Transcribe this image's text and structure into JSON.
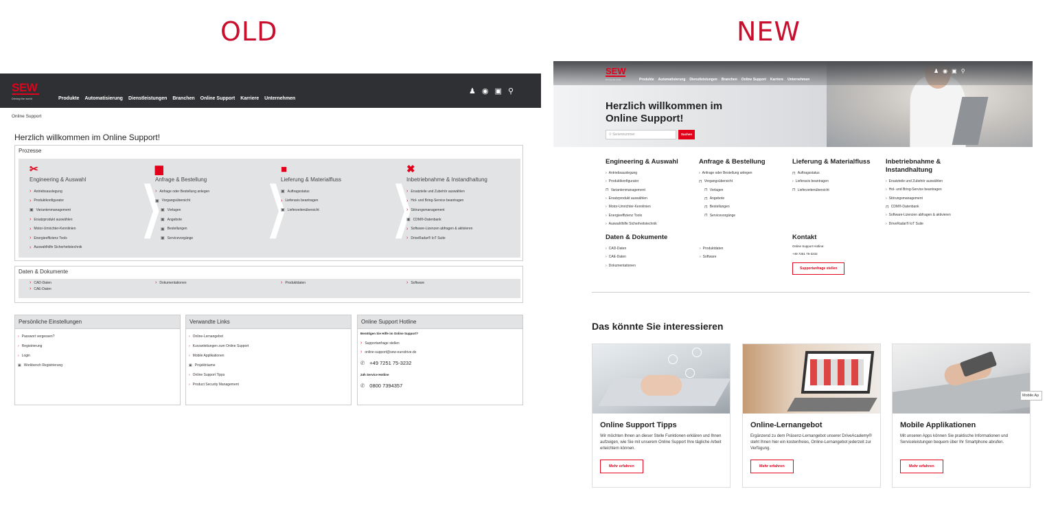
{
  "labels": {
    "old": "OLD",
    "new": "NEW"
  },
  "brand": {
    "logo": "SEW",
    "tagline": "Driving the world"
  },
  "nav": [
    "Produkte",
    "Automatisierung",
    "Dienstleistungen",
    "Branchen",
    "Online Support",
    "Karriere",
    "Unternehmen"
  ],
  "old": {
    "breadcrumb": "Online Support",
    "title": "Herzlich willkommen im Online Support!",
    "prozesse_title": "Prozesse",
    "columns": [
      {
        "title": "Engineering & Auswahl",
        "items": [
          {
            "t": "Antriebsauslegung",
            "lock": false
          },
          {
            "t": "Produktkonfigurator",
            "lock": false
          },
          {
            "t": "Variantenmanagement",
            "lock": true
          },
          {
            "t": "Ersatzprodukt auswählen",
            "lock": false
          },
          {
            "t": "Motor-Umrichter-Kennlinien",
            "lock": false
          },
          {
            "t": "Energieeffizienz Tools",
            "lock": false
          },
          {
            "t": "Auswahlhilfe Sicherheitstechnik",
            "lock": false
          }
        ]
      },
      {
        "title": "Anfrage & Bestellung",
        "items": [
          {
            "t": "Anfrage oder Bestellung anlegen",
            "lock": false
          },
          {
            "t": "Vorgangsübersicht",
            "lock": true
          },
          {
            "t": "Vorlagen",
            "lock": true
          },
          {
            "t": "Angebote",
            "lock": true
          },
          {
            "t": "Bestellungen",
            "lock": true
          },
          {
            "t": "Servicevorgänge",
            "lock": true
          }
        ]
      },
      {
        "title": "Lieferung & Materialfluss",
        "items": [
          {
            "t": "Auftragsstatus",
            "lock": true
          },
          {
            "t": "Lieferavis beantragen",
            "lock": false
          },
          {
            "t": "Lieferzeitenübersicht",
            "lock": true
          }
        ]
      },
      {
        "title": "Inbetriebnahme & Instandhaltung",
        "items": [
          {
            "t": "Ersatzteile und Zubehör auswählen",
            "lock": false
          },
          {
            "t": "Hol- und Bring-Service beantragen",
            "lock": false
          },
          {
            "t": "Störungsmanagement",
            "lock": false
          },
          {
            "t": "CDM®-Datenbank",
            "lock": true
          },
          {
            "t": "Software-Lizenzen abfragen & aktivieren",
            "lock": false
          },
          {
            "t": "DriveRadar® IoT Suite",
            "lock": false
          }
        ]
      }
    ],
    "daten_title": "Daten & Dokumente",
    "daten": [
      "CAD-Daten",
      "CAE-Daten",
      "Dokumentationen",
      "Produktdaten",
      "Software"
    ],
    "pers_title": "Persönliche Einstellungen",
    "pers": [
      {
        "t": "Passwort vergessen?",
        "lock": false
      },
      {
        "t": "Registrierung",
        "lock": false
      },
      {
        "t": "Login",
        "lock": false
      },
      {
        "t": "Workbench Registrierung",
        "lock": true
      }
    ],
    "links_title": "Verwandte Links",
    "links": [
      {
        "t": "Online-Lernangebot",
        "lock": false
      },
      {
        "t": "Kurzanleitungen zum Online Support",
        "lock": false
      },
      {
        "t": "Mobile Applikationen",
        "lock": false
      },
      {
        "t": "Projekträume",
        "lock": true
      },
      {
        "t": "Online Support Tipps",
        "lock": false
      },
      {
        "t": "Product Security Management",
        "lock": false
      }
    ],
    "hotline_title": "Online Support Hotline",
    "hotline_q": "Benötigen Sie Hilfe im Online Support?",
    "hotline_items": [
      "Supportanfrage stellen",
      "online-support@sew-eurodrive.de"
    ],
    "hotline_phone": "+49 7251 75-3232",
    "service_title": "24h Service Hotline",
    "service_phone": "0800 7394357"
  },
  "new": {
    "hero_title": "Herzlich willkommen im Online Support!",
    "search_placeholder": "Seriennummer",
    "search_btn": "Suchen",
    "columns": [
      {
        "title": "Engineering & Auswahl",
        "items": [
          {
            "t": "Antriebsauslegung",
            "lock": false
          },
          {
            "t": "Produktkonfigurator",
            "lock": false
          },
          {
            "t": "Variantenmanagement",
            "lock": true
          },
          {
            "t": "Ersatzprodukt auswählen",
            "lock": false
          },
          {
            "t": "Motor-Umrichter-Kennlinien",
            "lock": false
          },
          {
            "t": "Energieeffizienz Tools",
            "lock": false
          },
          {
            "t": "Auswahlhilfe Sicherheitstechnik",
            "lock": false
          }
        ]
      },
      {
        "title": "Anfrage & Bestellung",
        "items": [
          {
            "t": "Anfrage oder Bestellung anlegen",
            "lock": false
          },
          {
            "t": "Vorgangsübersicht",
            "lock": true
          },
          {
            "t": "Vorlagen",
            "lock": true,
            "sub": true
          },
          {
            "t": "Angebote",
            "lock": true,
            "sub": true
          },
          {
            "t": "Bestellungen",
            "lock": true,
            "sub": true
          },
          {
            "t": "Servicevorgänge",
            "lock": true,
            "sub": true
          }
        ]
      },
      {
        "title": "Lieferung & Materialfluss",
        "items": [
          {
            "t": "Auftragsstatus",
            "lock": true
          },
          {
            "t": "Lieferavis beantragen",
            "lock": false
          },
          {
            "t": "Lieferzeitenübersicht",
            "lock": true
          }
        ]
      },
      {
        "title": "Inbetriebnahme & Instandhaltung",
        "items": [
          {
            "t": "Ersatzteile und Zubehör auswählen",
            "lock": false
          },
          {
            "t": "Hol- und Bring-Service beantragen",
            "lock": false
          },
          {
            "t": "Störungsmanagement",
            "lock": false
          },
          {
            "t": "CDM®-Datenbank",
            "lock": true
          },
          {
            "t": "Software-Lizenzen abfragen & aktivieren",
            "lock": false
          },
          {
            "t": "DriveRadar® IoT Suite",
            "lock": false
          }
        ]
      }
    ],
    "daten_title": "Daten & Dokumente",
    "daten_a": [
      "CAD-Daten",
      "CAE-Daten",
      "Dokumentationen"
    ],
    "daten_b": [
      "Produktdaten",
      "Software"
    ],
    "kontakt_title": "Kontakt",
    "kontakt_line1": "Online Support Hotline:",
    "kontakt_line2": "+49 7251 75-3232",
    "kontakt_btn": "Supportanfrage stellen",
    "interest_title": "Das könnte Sie interessieren",
    "cards": [
      {
        "title": "Online Support Tipps",
        "text": "Wir möchten Ihnen an dieser Stelle Funktionen erklären und Ihnen aufzeigen, wie Sie mit unserem Online Support Ihre tägliche Arbeit erleichtern können.",
        "btn": "Mehr erfahren"
      },
      {
        "title": "Online-Lernangebot",
        "text": "Ergänzend zu dem Präsenz-Lernangebot unserer DriveAcademy® steht Ihnen hier ein kostenfreies, Online-Lernangebot jederzeit zur Verfügung.",
        "btn": "Mehr erfahren"
      },
      {
        "title": "Mobile Applikationen",
        "text": "Mit unseren Apps können Sie praktische Informationen und Serviceleistungen bequem über Ihr Smartphone abrufen.",
        "btn": "Mehr erfahren"
      }
    ],
    "tooltip": "Mobile Ap"
  },
  "colors": {
    "red": "#e2001a",
    "dark": "#2e3033",
    "panel": "#e2e3e4"
  }
}
